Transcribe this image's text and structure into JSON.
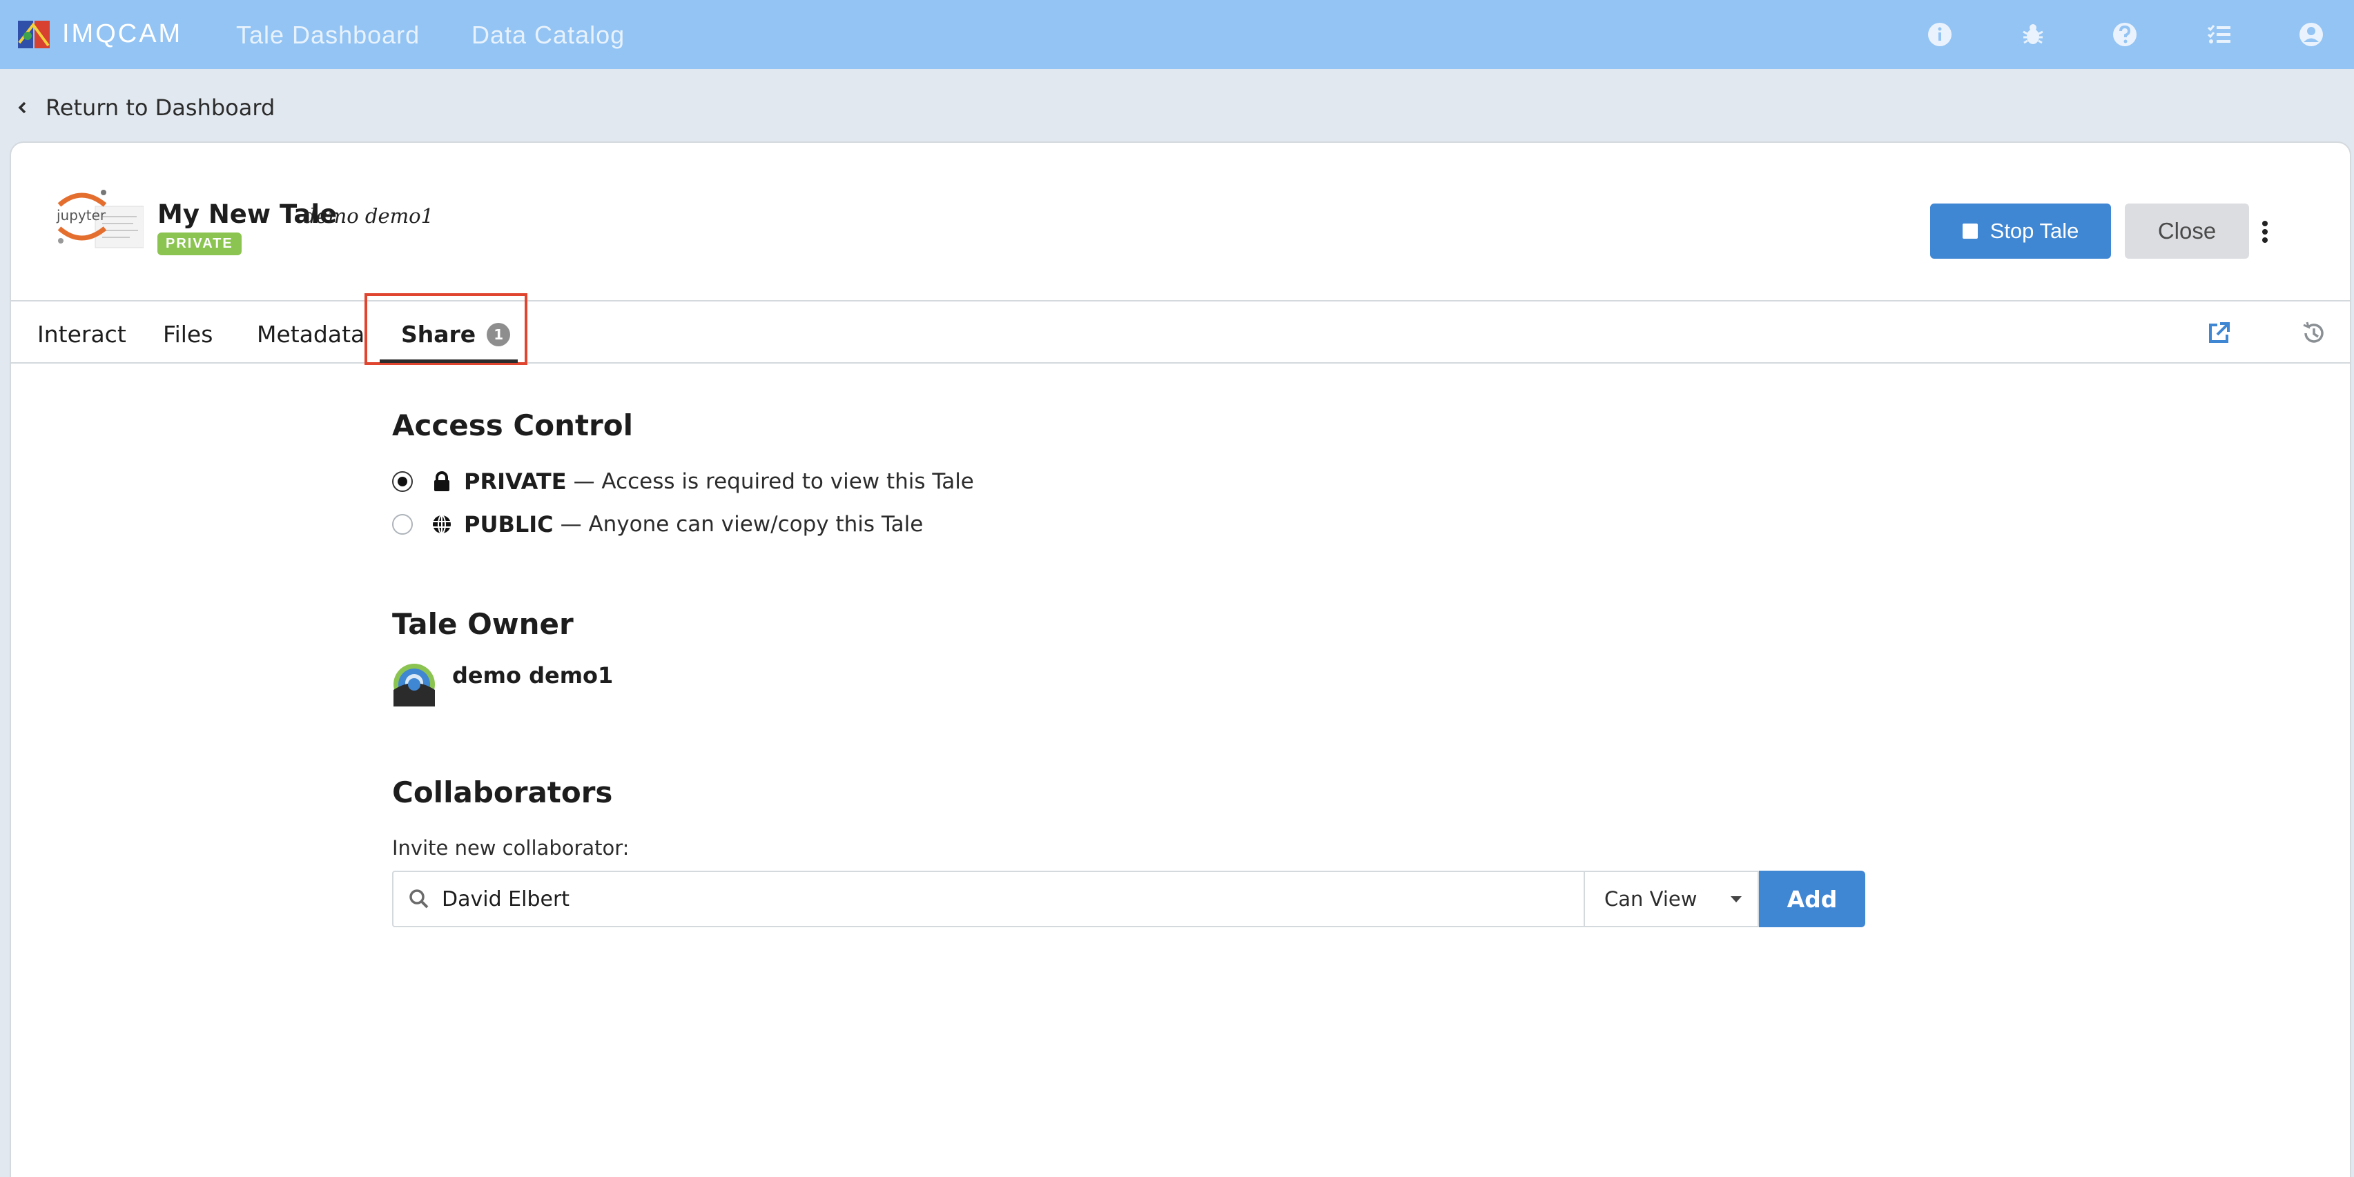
{
  "navbar": {
    "brand": "IMQCAM",
    "links": [
      "Tale Dashboard",
      "Data Catalog"
    ],
    "icons": [
      "info-icon",
      "bug-icon",
      "help-icon",
      "tasks-icon",
      "user-icon"
    ]
  },
  "return_link": "Return to Dashboard",
  "tale": {
    "title": "My New Tale",
    "author": "demo demo1",
    "badge": "PRIVATE",
    "stop_label": "Stop Tale",
    "close_label": "Close"
  },
  "tabs": {
    "interact": "Interact",
    "files": "Files",
    "metadata": "Metadata",
    "share": "Share",
    "share_count": "1"
  },
  "access_control": {
    "heading": "Access Control",
    "private": {
      "name": "PRIVATE",
      "desc": "— Access is required to view this Tale",
      "checked": true
    },
    "public": {
      "name": "PUBLIC",
      "desc": "— Anyone can view/copy this Tale",
      "checked": false
    }
  },
  "owner": {
    "heading": "Tale Owner",
    "name": "demo demo1"
  },
  "collaborators": {
    "heading": "Collaborators",
    "invite_label": "Invite new collaborator:",
    "search_value": "David Elbert",
    "permission": "Can View",
    "add_label": "Add"
  },
  "colors": {
    "navbar": "#93c4f4",
    "primary": "#3f86d3",
    "badge": "#8cc452",
    "highlight": "#e0452f"
  }
}
